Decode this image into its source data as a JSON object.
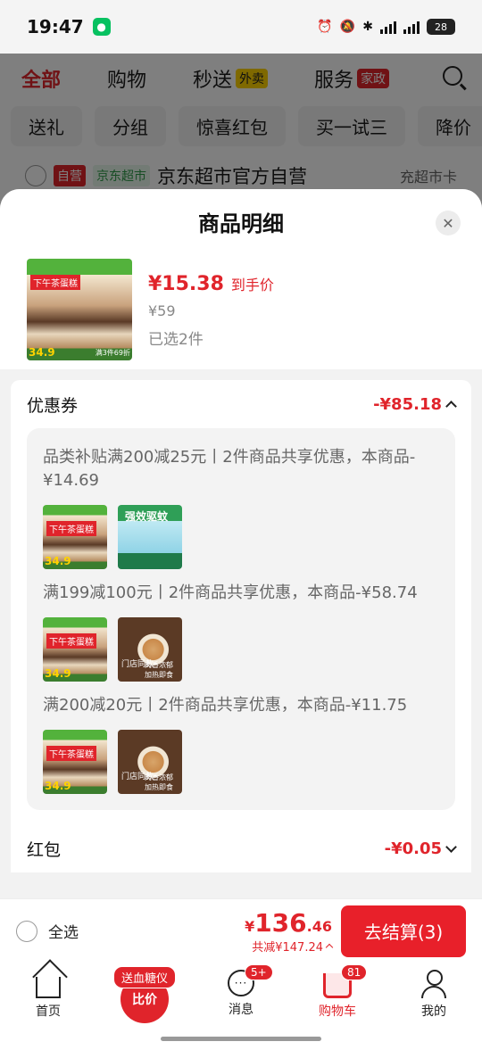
{
  "status_bar": {
    "time": "19:47",
    "battery": "28"
  },
  "bg_page": {
    "tabs": [
      "全部",
      "购物",
      "秒送",
      "服务"
    ],
    "tab_tags": {
      "秒送": "外卖",
      "服务": "家政"
    },
    "chips": [
      "送礼",
      "分组",
      "惊喜红包",
      "买一试三",
      "降价"
    ],
    "store": {
      "badge_self": "自营",
      "badge_market": "京东超市",
      "name": "京东超市官方自营",
      "right": "充超市卡"
    }
  },
  "sheet": {
    "title": "商品明细",
    "product": {
      "thumb_text": "下午茶蛋糕",
      "thumb_price": "34.9",
      "thumb_promo": "满3件69折",
      "deal_price": "¥15.38",
      "deal_label": "到手价",
      "orig_price": "¥59",
      "selected": "已选2件"
    },
    "coupons": {
      "title": "优惠券",
      "amount": "-¥85.18",
      "items": [
        {
          "desc": "品类补贴满200减25元丨2件商品共享优惠，本商品-¥14.69",
          "imgs": [
            "cake",
            "spray"
          ]
        },
        {
          "desc": "满199减100元丨2件商品共享优惠，本商品-¥58.74",
          "imgs": [
            "cake",
            "bowl"
          ]
        },
        {
          "desc": "满200减20元丨2件商品共享优惠，本商品-¥11.75",
          "imgs": [
            "cake",
            "bowl"
          ]
        }
      ],
      "spray_text": "强效驱蚊",
      "bowl_text": "门店同款",
      "bowl_sub": "肉香浓郁 加热即食"
    },
    "redpacket": {
      "title": "红包",
      "amount": "-¥0.05"
    }
  },
  "checkout": {
    "select_all": "全选",
    "currency": "¥",
    "total_int": "136",
    "total_dec": ".46",
    "saved": "共减¥147.24",
    "button": "去结算(3)"
  },
  "tabbar": {
    "items": [
      {
        "label": "首页",
        "icon": "home-icon"
      },
      {
        "label": "",
        "icon": "promo-icon",
        "pill": "送血糖仪",
        "promo": "比价"
      },
      {
        "label": "消息",
        "icon": "message-icon",
        "badge": "5+"
      },
      {
        "label": "购物车",
        "icon": "cart-icon",
        "badge": "81"
      },
      {
        "label": "我的",
        "icon": "profile-icon"
      }
    ]
  },
  "colors": {
    "accent": "#e0242b",
    "sheet_bg": "#f2f2f2"
  }
}
